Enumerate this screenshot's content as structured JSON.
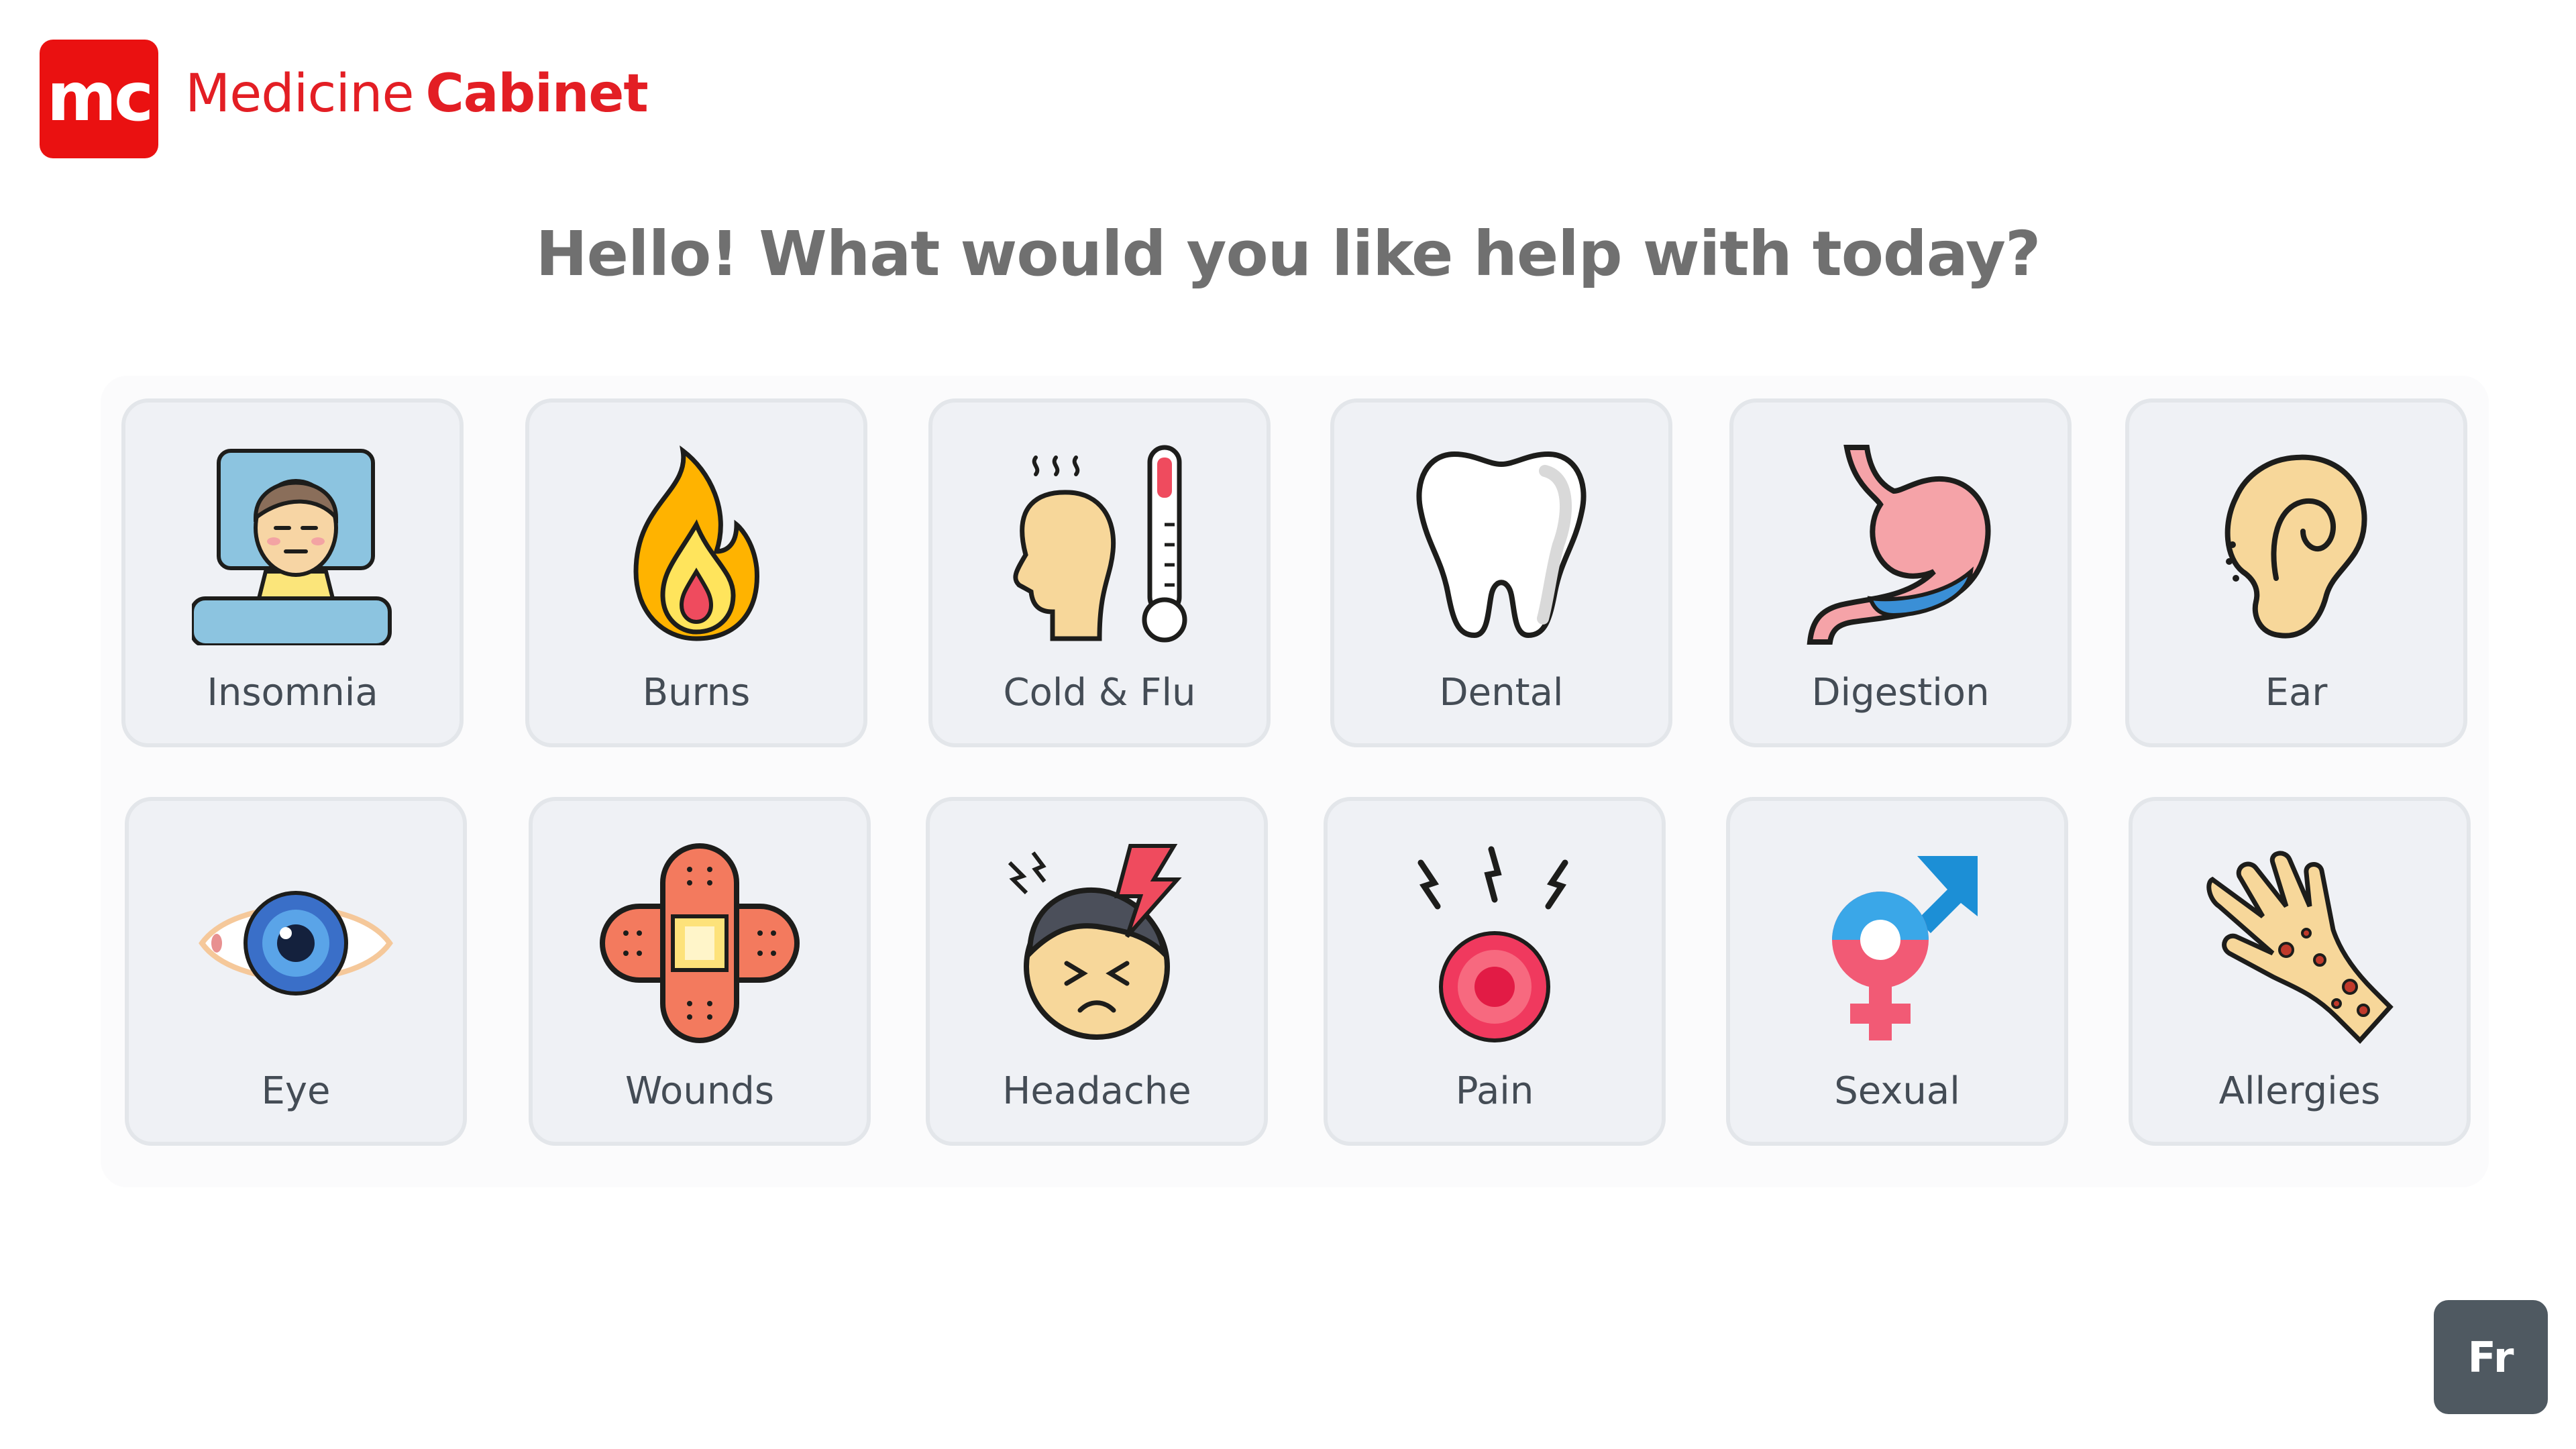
{
  "logo": {
    "mark": "mc",
    "name_regular": "Medicine",
    "name_bold": "Cabinet"
  },
  "heading": "Hello! What would you like help with today?",
  "categories": [
    {
      "label": "Insomnia",
      "icon": "insomnia-icon"
    },
    {
      "label": "Burns",
      "icon": "fire-icon"
    },
    {
      "label": "Cold & Flu",
      "icon": "fever-thermometer-icon"
    },
    {
      "label": "Dental",
      "icon": "tooth-icon"
    },
    {
      "label": "Digestion",
      "icon": "stomach-icon"
    },
    {
      "label": "Ear",
      "icon": "ear-icon"
    },
    {
      "label": "Eye",
      "icon": "eye-icon"
    },
    {
      "label": "Wounds",
      "icon": "bandage-icon"
    },
    {
      "label": "Headache",
      "icon": "headache-icon"
    },
    {
      "label": "Pain",
      "icon": "pain-target-icon"
    },
    {
      "label": "Sexual",
      "icon": "gender-symbol-icon"
    },
    {
      "label": "Allergies",
      "icon": "allergy-hand-icon"
    }
  ],
  "language_button": "Fr",
  "colors": {
    "brand": "#ea1111",
    "tile_bg": "#eff1f5",
    "tile_border": "#e3e6ea",
    "lang_bg": "#4f5961"
  }
}
